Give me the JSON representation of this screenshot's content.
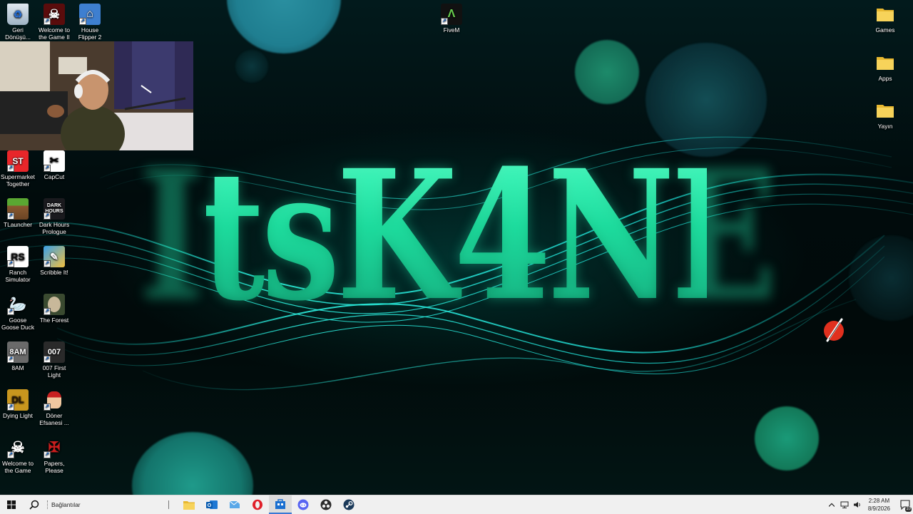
{
  "desktop": {
    "brand_text": "ItsK4NE",
    "left_icons": [
      {
        "label": "Geri Dönüşü...",
        "icon": "recycle-bin-icon"
      },
      {
        "label": "Welcome to the Game II",
        "icon": "skull-icon"
      },
      {
        "label": "House Flipper 2",
        "icon": "house-icon"
      },
      {
        "label": "Supermarket Together",
        "icon": "supermarket-icon"
      },
      {
        "label": "CapCut",
        "icon": "capcut-icon"
      },
      {
        "label": "TLauncher",
        "icon": "grass-block-icon"
      },
      {
        "label": "Dark Hours Prologue",
        "icon": "dark-hours-icon"
      },
      {
        "label": "Ranch Simulator",
        "icon": "ranch-icon"
      },
      {
        "label": "Scribble It!",
        "icon": "scribble-icon"
      },
      {
        "label": "Goose Goose Duck",
        "icon": "goose-icon"
      },
      {
        "label": "The Forest",
        "icon": "forest-icon"
      },
      {
        "label": "8AM",
        "icon": "8am-icon"
      },
      {
        "label": "007 First Light",
        "icon": "007-icon"
      },
      {
        "label": "Dying Light",
        "icon": "dying-light-icon"
      },
      {
        "label": "Döner Efsanesi ...",
        "icon": "doner-icon"
      },
      {
        "label": "Welcome to the Game",
        "icon": "skull-icon"
      },
      {
        "label": "Papers, Please",
        "icon": "papers-icon"
      }
    ],
    "center_icons": [
      {
        "label": "FiveM",
        "icon": "fivem-icon"
      }
    ],
    "right_icons": [
      {
        "label": "Games",
        "icon": "folder-icon"
      },
      {
        "label": "Apps",
        "icon": "folder-icon"
      },
      {
        "label": "Yayın",
        "icon": "folder-icon"
      }
    ]
  },
  "taskbar": {
    "search_label": "Bağlantılar",
    "apps": [
      "file-explorer-icon",
      "outlook-icon",
      "mail-icon",
      "opera-icon",
      "store-icon",
      "discord-icon",
      "obs-icon",
      "steam-icon"
    ],
    "clock_time": "2:28 AM",
    "clock_date": "8/9/2026",
    "notification_count": "10"
  },
  "colors": {
    "accent": "#3a78d4",
    "brand_green": "#2fe0a0",
    "taskbar_bg": "#f0f0f0"
  }
}
